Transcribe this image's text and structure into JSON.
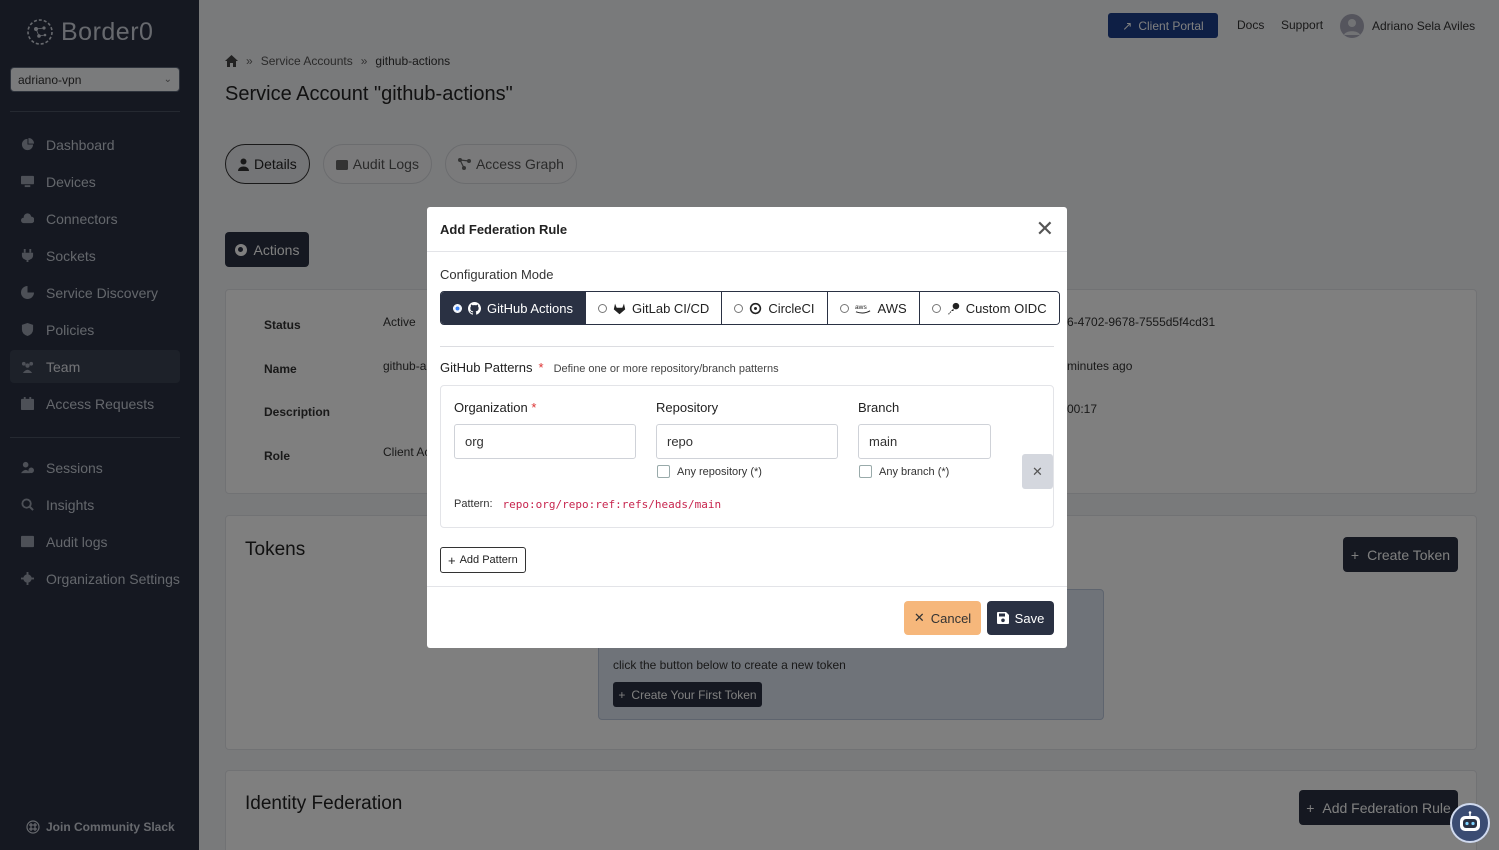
{
  "sidebar": {
    "logo_text": "Border0",
    "org_select": "adriano-vpn",
    "nav_primary": [
      {
        "label": "Dashboard",
        "icon": "dashboard-icon"
      },
      {
        "label": "Devices",
        "icon": "monitor-icon"
      },
      {
        "label": "Connectors",
        "icon": "cloud-icon"
      },
      {
        "label": "Sockets",
        "icon": "plug-icon"
      },
      {
        "label": "Service Discovery",
        "icon": "radar-icon"
      },
      {
        "label": "Policies",
        "icon": "shield-icon"
      },
      {
        "label": "Team",
        "icon": "team-icon"
      },
      {
        "label": "Access Requests",
        "icon": "calendar-icon"
      }
    ],
    "nav_secondary": [
      {
        "label": "Sessions",
        "icon": "user-clock-icon"
      },
      {
        "label": "Insights",
        "icon": "search-icon"
      },
      {
        "label": "Audit logs",
        "icon": "list-icon"
      },
      {
        "label": "Organization Settings",
        "icon": "gear-icon"
      }
    ],
    "active_item": "Team",
    "slack_label": "Join Community Slack"
  },
  "header": {
    "client_portal": "Client Portal",
    "docs": "Docs",
    "support": "Support",
    "user_name": "Adriano Sela Aviles"
  },
  "breadcrumb": {
    "items": [
      "Service Accounts",
      "github-actions"
    ]
  },
  "page": {
    "title": "Service Account \"github-actions\"",
    "tabs": [
      {
        "label": "Details",
        "icon": "user-icon"
      },
      {
        "label": "Audit Logs",
        "icon": "wallet-icon"
      },
      {
        "label": "Access Graph",
        "icon": "graph-icon"
      }
    ],
    "actions_label": "Actions"
  },
  "details": {
    "rows": [
      {
        "label": "Status",
        "value": "Active"
      },
      {
        "label": "Name",
        "value": "github-a"
      },
      {
        "label": "Description",
        "value": ""
      },
      {
        "label": "Role",
        "value": "Client Ac"
      }
    ],
    "right_values": [
      "6-4702-9678-7555d5f4cd31",
      "minutes ago",
      "00:17"
    ]
  },
  "tokens": {
    "title": "Tokens",
    "create_button": "Create Token",
    "empty_text": "click the button below to create a new token",
    "first_token_button": "Create Your First Token"
  },
  "identity_federation": {
    "title": "Identity Federation",
    "add_button": "Add Federation Rule"
  },
  "modal": {
    "title": "Add Federation Rule",
    "config_mode_label": "Configuration Mode",
    "modes": [
      {
        "label": "GitHub Actions",
        "icon": "github-icon",
        "selected": true
      },
      {
        "label": "GitLab CI/CD",
        "icon": "gitlab-icon",
        "selected": false
      },
      {
        "label": "CircleCI",
        "icon": "circleci-icon",
        "selected": false
      },
      {
        "label": "AWS",
        "icon": "aws-icon",
        "selected": false
      },
      {
        "label": "Custom OIDC",
        "icon": "key-icon",
        "selected": false
      }
    ],
    "patterns_label": "GitHub Patterns",
    "patterns_required": "*",
    "patterns_hint": "Define one or more repository/branch patterns",
    "organization_label": "Organization",
    "organization_required": "*",
    "organization_value": "org",
    "repository_label": "Repository",
    "repository_value": "repo",
    "any_repository": "Any repository (*)",
    "branch_label": "Branch",
    "branch_value": "main",
    "any_branch": "Any branch (*)",
    "pattern_label": "Pattern:",
    "pattern_value": "repo:org/repo:ref:refs/heads/main",
    "add_pattern": "Add Pattern",
    "cancel": "Cancel",
    "save": "Save"
  }
}
